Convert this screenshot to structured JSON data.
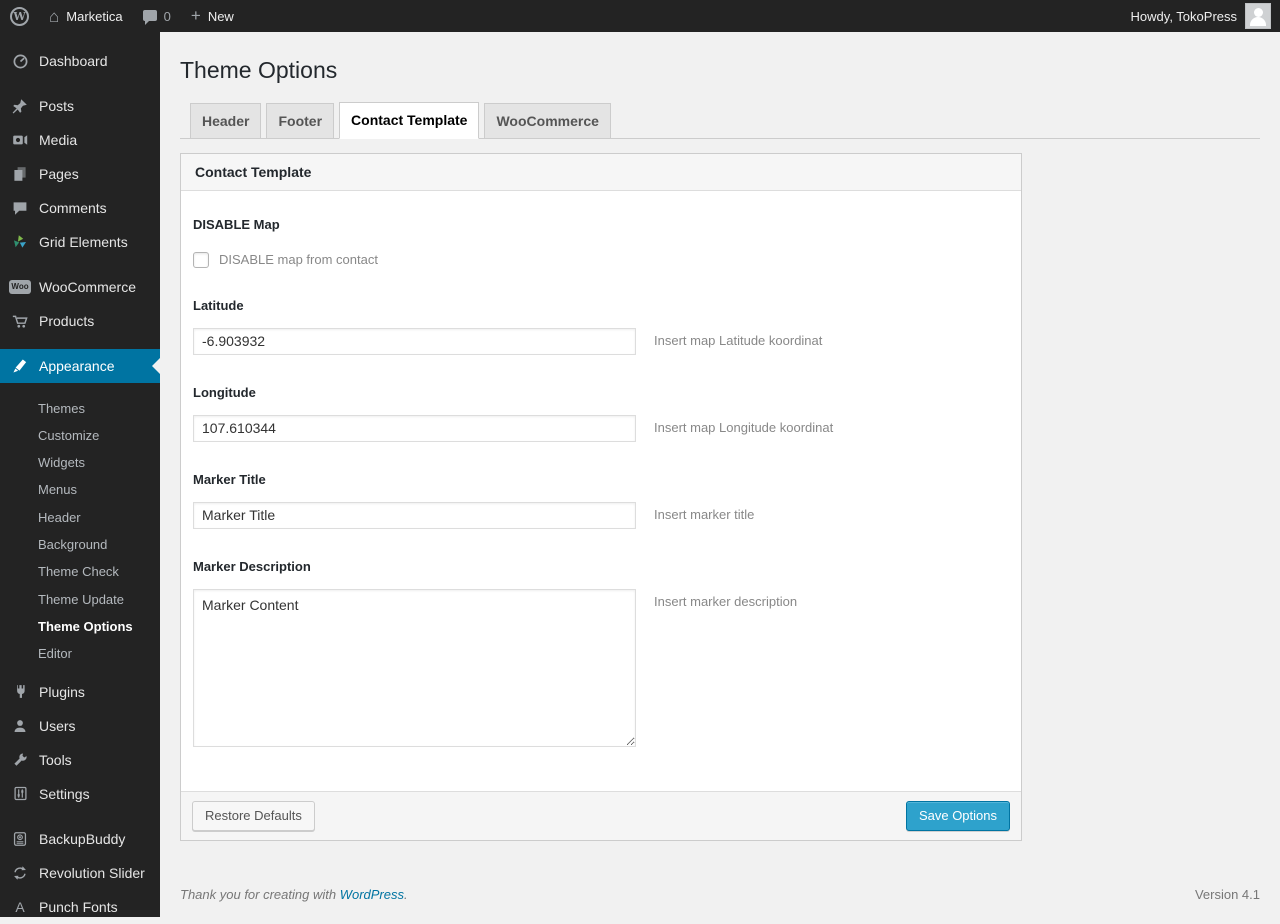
{
  "admin_bar": {
    "site_name": "Marketica",
    "comment_count": "0",
    "new_label": "New",
    "howdy_text": "Howdy, TokoPress"
  },
  "sidebar": {
    "items": [
      {
        "label": "Dashboard",
        "icon": "dashboard-icon"
      },
      {
        "label": "Posts",
        "icon": "pin-icon"
      },
      {
        "label": "Media",
        "icon": "media-icon"
      },
      {
        "label": "Pages",
        "icon": "pages-icon"
      },
      {
        "label": "Comments",
        "icon": "comment-icon"
      },
      {
        "label": "Grid Elements",
        "icon": "grid-elements-icon"
      },
      {
        "label": "WooCommerce",
        "icon": "woocommerce-badge-icon"
      },
      {
        "label": "Products",
        "icon": "cart-icon"
      },
      {
        "label": "Appearance",
        "icon": "brush-icon",
        "active": true
      },
      {
        "label": "Plugins",
        "icon": "plugin-icon"
      },
      {
        "label": "Users",
        "icon": "users-icon"
      },
      {
        "label": "Tools",
        "icon": "tools-icon"
      },
      {
        "label": "Settings",
        "icon": "settings-icon"
      },
      {
        "label": "BackupBuddy",
        "icon": "backup-disk-icon"
      },
      {
        "label": "Revolution Slider",
        "icon": "refresh-arrows-icon"
      },
      {
        "label": "Punch Fonts",
        "icon": "letter-a-icon"
      }
    ],
    "appearance_submenu": [
      {
        "label": "Themes"
      },
      {
        "label": "Customize"
      },
      {
        "label": "Widgets"
      },
      {
        "label": "Menus"
      },
      {
        "label": "Header"
      },
      {
        "label": "Background"
      },
      {
        "label": "Theme Check"
      },
      {
        "label": "Theme Update"
      },
      {
        "label": "Theme Options",
        "current": true
      },
      {
        "label": "Editor"
      }
    ]
  },
  "page": {
    "title": "Theme Options",
    "tabs": [
      {
        "label": "Header",
        "active": false
      },
      {
        "label": "Footer",
        "active": false
      },
      {
        "label": "Contact Template",
        "active": true
      },
      {
        "label": "WooCommerce",
        "active": false
      }
    ],
    "panel": {
      "header": "Contact Template",
      "fields": {
        "disable_map": {
          "label": "DISABLE Map",
          "checkbox_label": "DISABLE map from contact",
          "checked": false
        },
        "latitude": {
          "label": "Latitude",
          "value": "-6.903932",
          "help": "Insert map Latitude koordinat"
        },
        "longitude": {
          "label": "Longitude",
          "value": "107.610344",
          "help": "Insert map Longitude koordinat"
        },
        "marker_title": {
          "label": "Marker Title",
          "value": "Marker Title",
          "help": "Insert marker title"
        },
        "marker_description": {
          "label": "Marker Description",
          "value": "Marker Content",
          "help": "Insert marker description"
        }
      },
      "footer_buttons": {
        "restore": "Restore Defaults",
        "save": "Save Options"
      }
    },
    "footer": {
      "thanks_prefix": "Thank you for creating with ",
      "wordpress_link": "WordPress",
      "thanks_suffix": ".",
      "version": "Version 4.1"
    }
  },
  "colors": {
    "adminbar_bg": "#232323",
    "menu_active_bg": "#0074a2",
    "content_bg": "#f1f1f1",
    "icon_gray": "#a0a5aa",
    "primary_button_bg": "#2ea2cc",
    "primary_button_border": "#0074a2",
    "link_blue": "#0074a2",
    "grid_icon_green": "#7fb84a",
    "grid_icon_blue": "#3aa3c8",
    "grid_icon_teal": "#2f8f6f"
  }
}
